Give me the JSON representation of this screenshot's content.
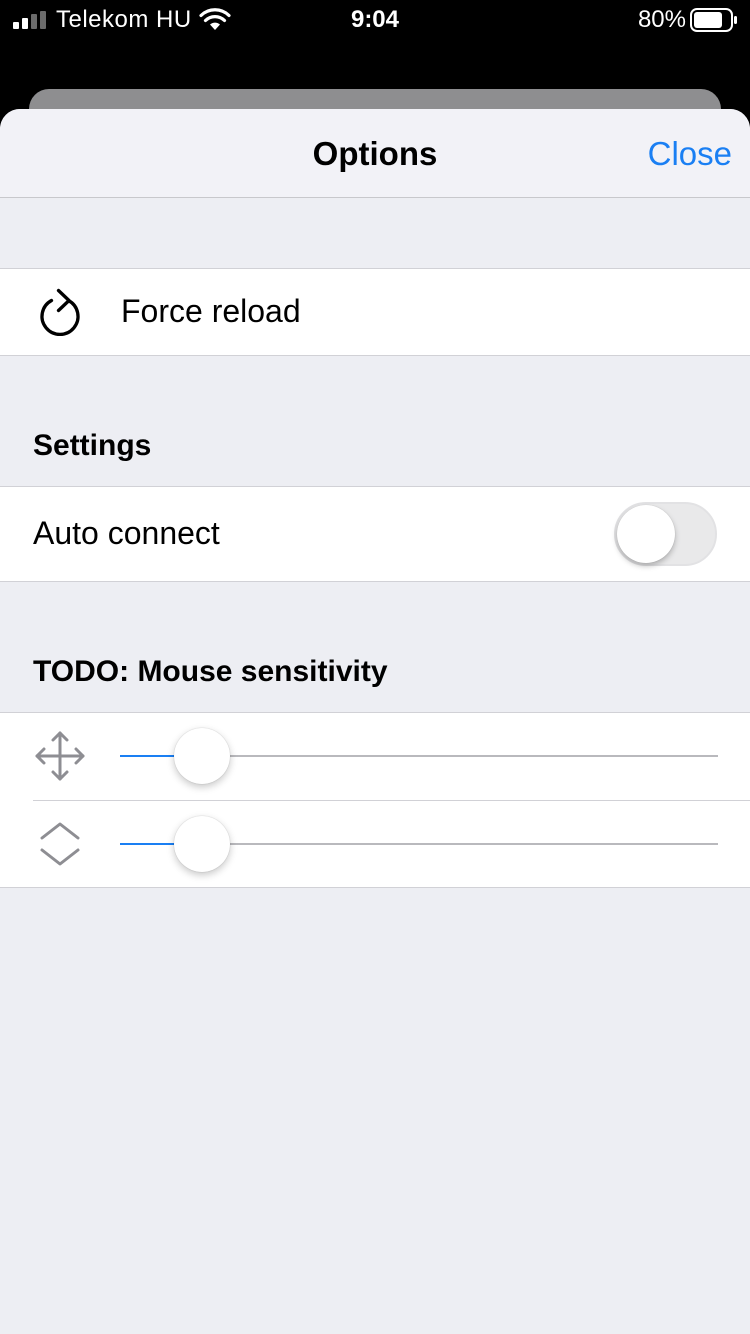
{
  "status_bar": {
    "carrier": "Telekom HU",
    "time": "9:04",
    "battery_percent": "80%",
    "battery_level": 0.8,
    "icons": [
      "signal-icon",
      "wifi-icon",
      "battery-icon"
    ]
  },
  "nav": {
    "title": "Options",
    "close_label": "Close"
  },
  "actions": {
    "force_reload_label": "Force reload",
    "force_reload_icon": "reload-icon"
  },
  "settings": {
    "header": "Settings",
    "auto_connect_label": "Auto connect",
    "auto_connect_on": false
  },
  "mouse": {
    "header": "TODO: Mouse sensitivity",
    "sliders": [
      {
        "icon": "move-arrows-icon",
        "value": 0.1
      },
      {
        "icon": "scroll-chevrons-icon",
        "value": 0.1
      }
    ]
  },
  "colors": {
    "accent": "#1a7ff3",
    "background": "#edeef3",
    "toggle_off": "#e9e9ea"
  }
}
